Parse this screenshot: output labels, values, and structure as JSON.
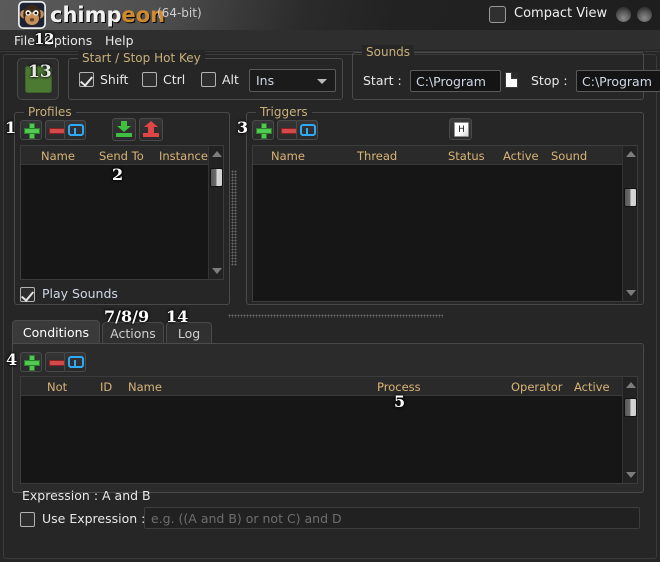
{
  "window": {
    "brand_chimp": "chimp",
    "brand_eon": "eon",
    "bits": "(64-bit)",
    "compact_view_label": "Compact View",
    "logo_icon": "monkey-logo-icon",
    "min_button_icon": "minimize-button-icon",
    "close_button_icon": "close-button-icon"
  },
  "menubar": {
    "file": "File",
    "options": "Options",
    "help": "Help"
  },
  "start_button": {
    "annotation": "13",
    "state_color": "#4d7a33"
  },
  "hotkey": {
    "legend": "Start / Stop Hot Key",
    "shift_label": "Shift",
    "shift_checked": true,
    "ctrl_label": "Ctrl",
    "ctrl_checked": false,
    "alt_label": "Alt",
    "alt_checked": false,
    "key_value": "Ins",
    "key_options": [
      "Ins"
    ]
  },
  "sounds": {
    "legend": "Sounds",
    "start_label": "Start :",
    "start_value": "C:\\Program",
    "start_browse_icon": "file-browse-icon",
    "stop_label": "Stop :",
    "stop_value": "C:\\Program",
    "stop_browse_icon": "file-browse-icon"
  },
  "profiles": {
    "legend": "Profiles",
    "annotation_toolbar": "1",
    "annotation_list": "2",
    "toolbar": [
      {
        "name": "add-profile-button",
        "icon": "plus-icon"
      },
      {
        "name": "remove-profile-button",
        "icon": "minus-icon"
      },
      {
        "name": "duplicate-profile-button",
        "icon": "duplicate-icon"
      },
      {
        "name": "import-profile-button",
        "icon": "import-icon"
      },
      {
        "name": "export-profile-button",
        "icon": "export-icon"
      }
    ],
    "columns": [
      "Name",
      "Send To",
      "Instance"
    ],
    "rows": [],
    "play_sounds_label": "Play Sounds",
    "play_sounds_checked": true
  },
  "triggers": {
    "legend": "Triggers",
    "annotation_toolbar": "3",
    "toolbar": [
      {
        "name": "add-trigger-button",
        "icon": "plus-icon"
      },
      {
        "name": "remove-trigger-button",
        "icon": "minus-icon"
      },
      {
        "name": "duplicate-trigger-button",
        "icon": "duplicate-icon"
      }
    ],
    "hotkey_button_icon": "keyboard-key-icon",
    "hotkey_button_caption": "H",
    "columns": [
      "Name",
      "Thread",
      "Status",
      "Active",
      "Sound"
    ],
    "rows": []
  },
  "tabs": {
    "annotation_tabs": "7/8/9",
    "annotation_log": "14",
    "items": [
      {
        "label": "Conditions",
        "active": true
      },
      {
        "label": "Actions",
        "active": false
      },
      {
        "label": "Log",
        "active": false
      }
    ]
  },
  "conditions": {
    "annotation_toolbar": "4",
    "annotation_list": "5",
    "toolbar": [
      {
        "name": "add-condition-button",
        "icon": "plus-icon"
      },
      {
        "name": "remove-condition-button",
        "icon": "minus-icon"
      },
      {
        "name": "duplicate-condition-button",
        "icon": "duplicate-icon"
      }
    ],
    "columns": [
      "Not",
      "ID",
      "Name",
      "Process",
      "Operator",
      "Active"
    ],
    "rows": []
  },
  "expression": {
    "summary_label": "Expression : A and B",
    "use_label": "Use Expression :",
    "use_checked": false,
    "placeholder": "e.g. ((A and B) or not C) and D",
    "value": ""
  }
}
